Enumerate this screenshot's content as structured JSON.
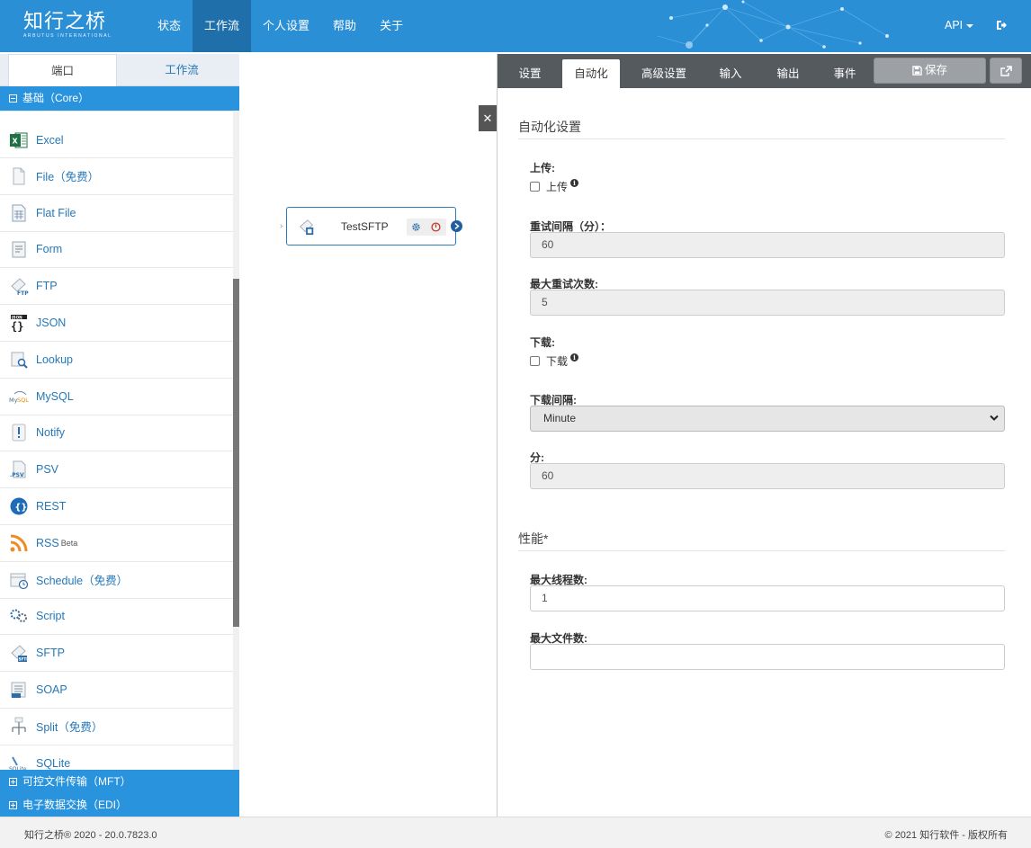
{
  "brand": {
    "name_cn": "知行之桥",
    "name_en": "ARBUTUS INTERNATIONAL"
  },
  "nav": {
    "items": [
      {
        "label": "状态"
      },
      {
        "label": "工作流"
      },
      {
        "label": "个人设置"
      },
      {
        "label": "帮助"
      },
      {
        "label": "关于"
      }
    ],
    "active": "工作流",
    "api_label": "API"
  },
  "left_panel": {
    "tabs": [
      {
        "label": "端口"
      },
      {
        "label": "工作流"
      }
    ],
    "active_tab": "端口",
    "categories": {
      "core": "基础（Core）",
      "mft": "可控文件传输（MFT）",
      "edi": "电子数据交换（EDI）"
    },
    "ports": [
      {
        "label": "Excel",
        "icon": "excel-icon"
      },
      {
        "label": "File（免费）",
        "icon": "file-icon"
      },
      {
        "label": "Flat File",
        "icon": "flat-file-icon"
      },
      {
        "label": "Form",
        "icon": "form-icon"
      },
      {
        "label": "FTP",
        "icon": "ftp-icon"
      },
      {
        "label": "JSON",
        "icon": "json-icon"
      },
      {
        "label": "Lookup",
        "icon": "lookup-icon"
      },
      {
        "label": "MySQL",
        "icon": "mysql-icon"
      },
      {
        "label": "Notify",
        "icon": "notify-icon"
      },
      {
        "label": "PSV",
        "icon": "psv-icon"
      },
      {
        "label": "REST",
        "icon": "rest-icon"
      },
      {
        "label": "RSS",
        "sup": "Beta",
        "icon": "rss-icon"
      },
      {
        "label": "Schedule（免费）",
        "icon": "schedule-icon"
      },
      {
        "label": "Script",
        "icon": "script-icon"
      },
      {
        "label": "SFTP",
        "icon": "sftp-icon"
      },
      {
        "label": "SOAP",
        "icon": "soap-icon"
      },
      {
        "label": "Split（免费）",
        "icon": "split-icon"
      },
      {
        "label": "SQLite",
        "icon": "sqlite-icon"
      }
    ]
  },
  "canvas": {
    "node": {
      "label": "TestSFTP",
      "icon": "sftp-icon"
    }
  },
  "right_panel": {
    "tabs": [
      {
        "label": "设置"
      },
      {
        "label": "自动化"
      },
      {
        "label": "高级设置"
      },
      {
        "label": "输入"
      },
      {
        "label": "输出"
      },
      {
        "label": "事件"
      }
    ],
    "active_tab": "自动化",
    "save_label": "保存",
    "automation": {
      "title": "自动化设置",
      "upload_label": "上传:",
      "upload_checkbox": "上传",
      "upload_checked": false,
      "retry_interval_label": "重试间隔（分）：",
      "retry_interval_value": "60",
      "max_retries_label": "最大重试次数:",
      "max_retries_value": "5",
      "download_label": "下载:",
      "download_checkbox": "下载",
      "download_checked": false,
      "download_interval_label": "下载间隔:",
      "download_interval_value": "Minute",
      "minutes_label": "分:",
      "minutes_value": "60"
    },
    "performance": {
      "title": "性能*",
      "max_threads_label": "最大线程数:",
      "max_threads_value": "1",
      "max_files_label": "最大文件数:",
      "max_files_value": ""
    }
  },
  "footer": {
    "left": "知行之桥® 2020 - 20.0.7823.0",
    "right": "© 2021 知行软件 - 版权所有"
  },
  "colors": {
    "topbar": "#2b8fd6",
    "nav_active": "#1f6fab",
    "category": "#2a93dd",
    "link": "#2578b8",
    "tabbar": "#555a5f"
  }
}
